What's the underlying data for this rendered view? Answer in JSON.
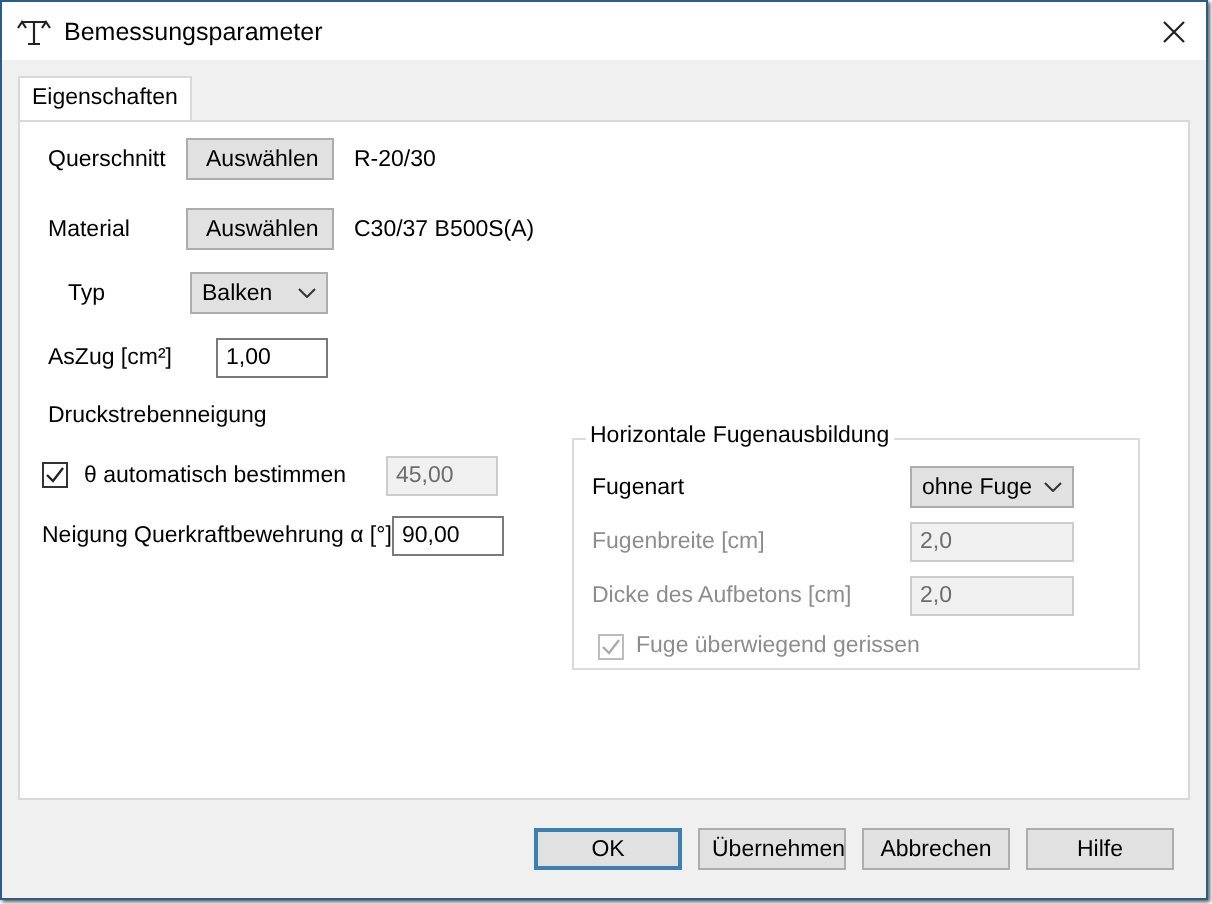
{
  "window": {
    "title": "Bemessungsparameter"
  },
  "tabs": [
    {
      "label": "Eigenschaften",
      "selected": true
    }
  ],
  "querschnitt": {
    "label": "Querschnitt",
    "button": "Auswählen",
    "value": "R-20/30"
  },
  "material": {
    "label": "Material",
    "button": "Auswählen",
    "value": "C30/37 B500S(A)"
  },
  "typ": {
    "label": "Typ",
    "value": "Balken"
  },
  "aszug": {
    "label": "AsZug [cm²]",
    "value": "1,00"
  },
  "druckstrebenneigung": {
    "heading": "Druckstrebenneigung",
    "theta": {
      "label": "θ automatisch bestimmen",
      "checked": true,
      "value": "45,00",
      "disabled": true
    },
    "alpha": {
      "label": "Neigung Querkraftbewehrung α [°]",
      "value": "90,00",
      "disabled": false
    }
  },
  "fugen": {
    "title": "Horizontale Fugenausbildung",
    "fugenart": {
      "label": "Fugenart",
      "value": "ohne Fuge"
    },
    "fields": [
      {
        "label": "Fugenbreite [cm]",
        "value": "2,0",
        "disabled": true
      },
      {
        "label": "Dicke des Aufbetons [cm]",
        "value": "2,0",
        "disabled": true
      }
    ],
    "gerissen": {
      "label": "Fuge überwiegend gerissen",
      "checked": true,
      "disabled": true
    }
  },
  "buttons": [
    {
      "label": "OK",
      "default": true
    },
    {
      "label": "Übernehmen",
      "default": false
    },
    {
      "label": "Abbrechen",
      "default": false
    },
    {
      "label": "Hilfe",
      "default": false
    }
  ]
}
